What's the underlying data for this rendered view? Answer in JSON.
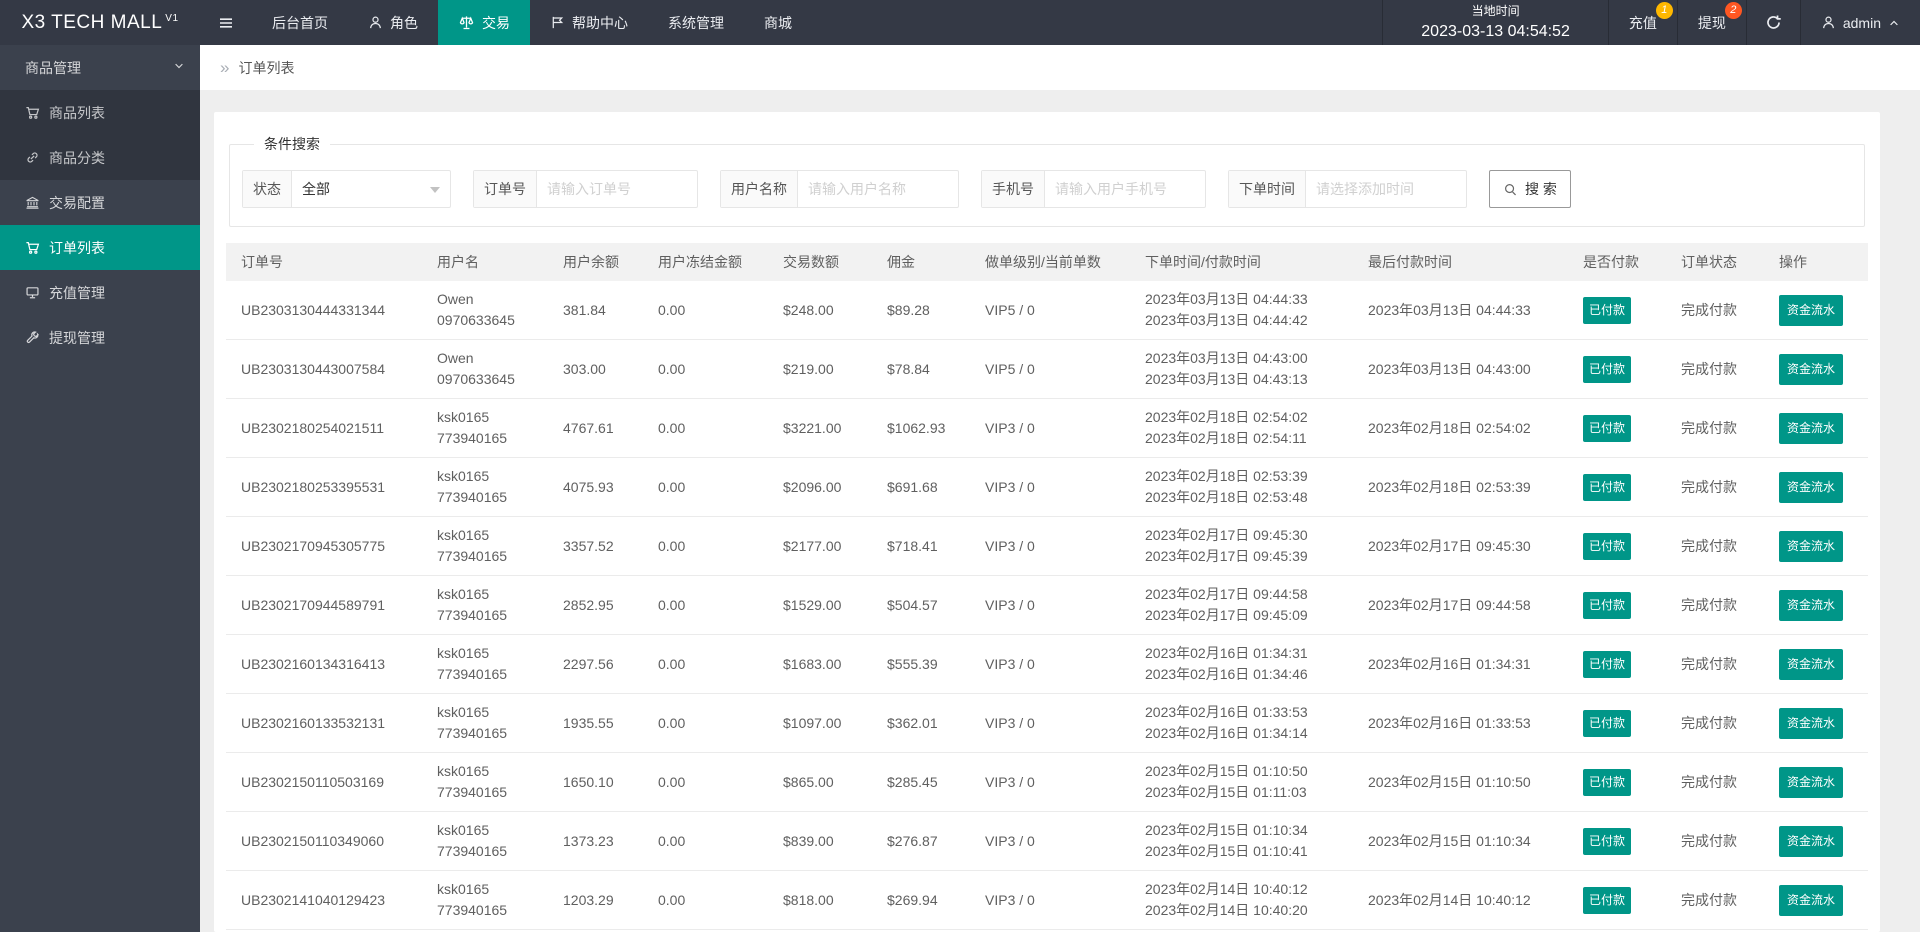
{
  "navbar": {
    "logo_text": "X3 TECH MALL",
    "logo_version": "V1",
    "menu": [
      {
        "label": "后台首页",
        "icon": "none"
      },
      {
        "label": "角色",
        "icon": "person-icon"
      },
      {
        "label": "交易",
        "icon": "balance-icon",
        "active": true
      },
      {
        "label": "帮助中心",
        "icon": "flag-icon"
      },
      {
        "label": "系统管理",
        "icon": "none"
      },
      {
        "label": "商城",
        "icon": "none"
      }
    ],
    "local_time_label": "当地时间",
    "local_time": "2023-03-13 04:54:52",
    "recharge_label": "充值",
    "recharge_badge": "1",
    "withdraw_label": "提现",
    "withdraw_badge": "2",
    "user_name": "admin"
  },
  "sidebar": {
    "items": [
      {
        "label": "商品管理",
        "type": "parent",
        "icon": "chevron-down-icon"
      },
      {
        "label": "商品列表",
        "type": "child",
        "icon": "cart-icon"
      },
      {
        "label": "商品分类",
        "type": "child",
        "icon": "link-icon"
      },
      {
        "label": "交易配置",
        "type": "item",
        "icon": "bank-icon"
      },
      {
        "label": "订单列表",
        "type": "item",
        "icon": "cart-icon",
        "active": true
      },
      {
        "label": "充值管理",
        "type": "item",
        "icon": "monitor-icon"
      },
      {
        "label": "提现管理",
        "type": "item",
        "icon": "wrench-icon"
      }
    ]
  },
  "breadcrumb": {
    "current": "订单列表"
  },
  "search": {
    "legend": "条件搜索",
    "status_label": "状态",
    "status_value": "全部",
    "order_label": "订单号",
    "order_placeholder": "请输入订单号",
    "username_label": "用户名称",
    "username_placeholder": "请输入用户名称",
    "phone_label": "手机号",
    "phone_placeholder": "请输入用户手机号",
    "time_label": "下单时间",
    "time_placeholder": "请选择添加时间",
    "button_label": "搜 索"
  },
  "table": {
    "columns": [
      "订单号",
      "用户名",
      "用户余额",
      "用户冻结金额",
      "交易数额",
      "佣金",
      "做单级别/当前单数",
      "下单时间/付款时间",
      "最后付款时间",
      "是否付款",
      "订单状态",
      "操作"
    ],
    "rows": [
      {
        "order_no": "UB2303130444331344",
        "user_name": "Owen",
        "user_account": "0970633645",
        "balance": "381.84",
        "frozen": "0.00",
        "amount": "$248.00",
        "commission": "$89.28",
        "level": "VIP5 / 0",
        "order_time": "2023年03月13日 04:44:33",
        "pay_time": "2023年03月13日 04:44:42",
        "last_pay_time": "2023年03月13日 04:44:33",
        "paid": "已付款",
        "status": "完成付款",
        "action": "资金流水"
      },
      {
        "order_no": "UB2303130443007584",
        "user_name": "Owen",
        "user_account": "0970633645",
        "balance": "303.00",
        "frozen": "0.00",
        "amount": "$219.00",
        "commission": "$78.84",
        "level": "VIP5 / 0",
        "order_time": "2023年03月13日 04:43:00",
        "pay_time": "2023年03月13日 04:43:13",
        "last_pay_time": "2023年03月13日 04:43:00",
        "paid": "已付款",
        "status": "完成付款",
        "action": "资金流水"
      },
      {
        "order_no": "UB2302180254021511",
        "user_name": "ksk0165",
        "user_account": "773940165",
        "balance": "4767.61",
        "frozen": "0.00",
        "amount": "$3221.00",
        "commission": "$1062.93",
        "level": "VIP3 / 0",
        "order_time": "2023年02月18日 02:54:02",
        "pay_time": "2023年02月18日 02:54:11",
        "last_pay_time": "2023年02月18日 02:54:02",
        "paid": "已付款",
        "status": "完成付款",
        "action": "资金流水"
      },
      {
        "order_no": "UB2302180253395531",
        "user_name": "ksk0165",
        "user_account": "773940165",
        "balance": "4075.93",
        "frozen": "0.00",
        "amount": "$2096.00",
        "commission": "$691.68",
        "level": "VIP3 / 0",
        "order_time": "2023年02月18日 02:53:39",
        "pay_time": "2023年02月18日 02:53:48",
        "last_pay_time": "2023年02月18日 02:53:39",
        "paid": "已付款",
        "status": "完成付款",
        "action": "资金流水"
      },
      {
        "order_no": "UB2302170945305775",
        "user_name": "ksk0165",
        "user_account": "773940165",
        "balance": "3357.52",
        "frozen": "0.00",
        "amount": "$2177.00",
        "commission": "$718.41",
        "level": "VIP3 / 0",
        "order_time": "2023年02月17日 09:45:30",
        "pay_time": "2023年02月17日 09:45:39",
        "last_pay_time": "2023年02月17日 09:45:30",
        "paid": "已付款",
        "status": "完成付款",
        "action": "资金流水"
      },
      {
        "order_no": "UB2302170944589791",
        "user_name": "ksk0165",
        "user_account": "773940165",
        "balance": "2852.95",
        "frozen": "0.00",
        "amount": "$1529.00",
        "commission": "$504.57",
        "level": "VIP3 / 0",
        "order_time": "2023年02月17日 09:44:58",
        "pay_time": "2023年02月17日 09:45:09",
        "last_pay_time": "2023年02月17日 09:44:58",
        "paid": "已付款",
        "status": "完成付款",
        "action": "资金流水"
      },
      {
        "order_no": "UB2302160134316413",
        "user_name": "ksk0165",
        "user_account": "773940165",
        "balance": "2297.56",
        "frozen": "0.00",
        "amount": "$1683.00",
        "commission": "$555.39",
        "level": "VIP3 / 0",
        "order_time": "2023年02月16日 01:34:31",
        "pay_time": "2023年02月16日 01:34:46",
        "last_pay_time": "2023年02月16日 01:34:31",
        "paid": "已付款",
        "status": "完成付款",
        "action": "资金流水"
      },
      {
        "order_no": "UB2302160133532131",
        "user_name": "ksk0165",
        "user_account": "773940165",
        "balance": "1935.55",
        "frozen": "0.00",
        "amount": "$1097.00",
        "commission": "$362.01",
        "level": "VIP3 / 0",
        "order_time": "2023年02月16日 01:33:53",
        "pay_time": "2023年02月16日 01:34:14",
        "last_pay_time": "2023年02月16日 01:33:53",
        "paid": "已付款",
        "status": "完成付款",
        "action": "资金流水"
      },
      {
        "order_no": "UB2302150110503169",
        "user_name": "ksk0165",
        "user_account": "773940165",
        "balance": "1650.10",
        "frozen": "0.00",
        "amount": "$865.00",
        "commission": "$285.45",
        "level": "VIP3 / 0",
        "order_time": "2023年02月15日 01:10:50",
        "pay_time": "2023年02月15日 01:11:03",
        "last_pay_time": "2023年02月15日 01:10:50",
        "paid": "已付款",
        "status": "完成付款",
        "action": "资金流水"
      },
      {
        "order_no": "UB2302150110349060",
        "user_name": "ksk0165",
        "user_account": "773940165",
        "balance": "1373.23",
        "frozen": "0.00",
        "amount": "$839.00",
        "commission": "$276.87",
        "level": "VIP3 / 0",
        "order_time": "2023年02月15日 01:10:34",
        "pay_time": "2023年02月15日 01:10:41",
        "last_pay_time": "2023年02月15日 01:10:34",
        "paid": "已付款",
        "status": "完成付款",
        "action": "资金流水"
      },
      {
        "order_no": "UB2302141040129423",
        "user_name": "ksk0165",
        "user_account": "773940165",
        "balance": "1203.29",
        "frozen": "0.00",
        "amount": "$818.00",
        "commission": "$269.94",
        "level": "VIP3 / 0",
        "order_time": "2023年02月14日 10:40:12",
        "pay_time": "2023年02月14日 10:40:20",
        "last_pay_time": "2023年02月14日 10:40:12",
        "paid": "已付款",
        "status": "完成付款",
        "action": "资金流水"
      }
    ]
  },
  "colors": {
    "accent_teal": "#009688",
    "navbar_bg": "#343945",
    "sidebar_bg": "#3b414d",
    "sidebar_child_bg": "#30353f",
    "badge_orange": "#ffb800",
    "badge_red": "#ff5722",
    "page_bg": "#eeeeee",
    "table_header_bg": "#f2f2f2"
  }
}
